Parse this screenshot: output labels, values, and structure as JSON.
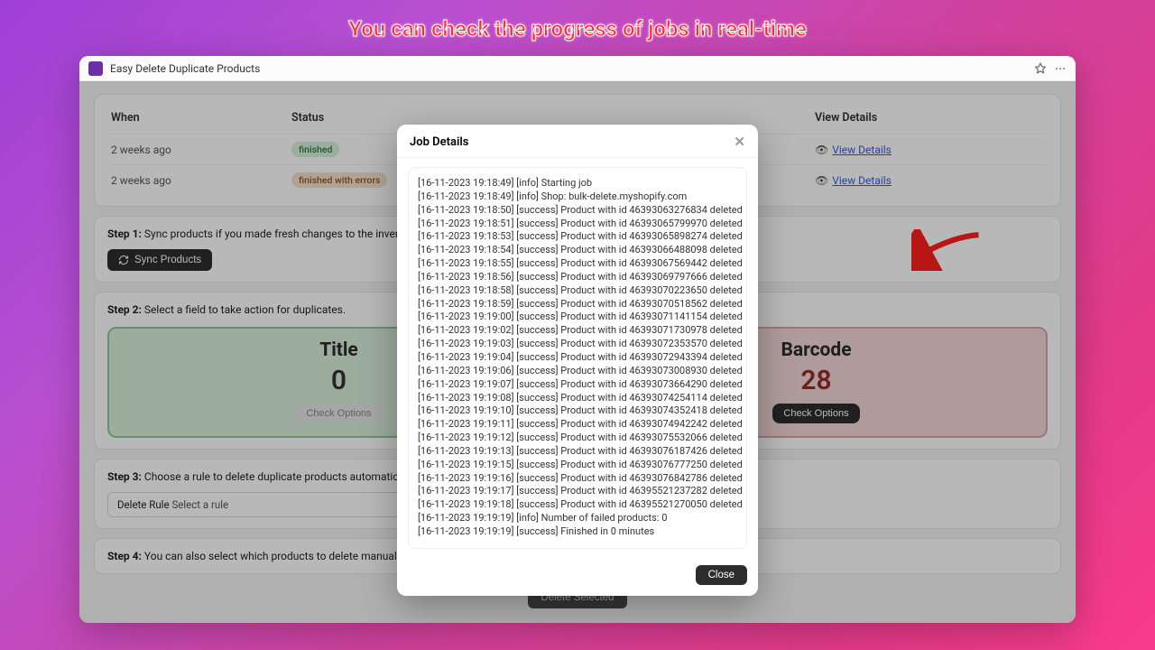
{
  "banner": "You can check the progress of jobs in real-time",
  "app_title": "Easy Delete Duplicate Products",
  "table": {
    "headers": {
      "when": "When",
      "status": "Status",
      "view": "View Details"
    },
    "rows": [
      {
        "when": "2 weeks ago",
        "status_label": "finished",
        "status_kind": "green",
        "view": "View Details"
      },
      {
        "when": "2 weeks ago",
        "status_label": "finished with errors",
        "status_kind": "amber",
        "view": "View Details"
      }
    ]
  },
  "steps": {
    "s1_label": "Step 1:",
    "s1_text": "Sync products if you made fresh changes to the inventory.",
    "sync_btn": "Sync Products",
    "s2_label": "Step 2:",
    "s2_text": "Select a field to take action for duplicates.",
    "s3_label": "Step 3:",
    "s3_text": "Choose a rule to delete duplicate products automatically in bulk.",
    "select_label": "Delete Rule",
    "select_placeholder": "Select a rule",
    "s4_label": "Step 4:",
    "s4_text": "You can also select which products to delete manually.",
    "delete_selected": "Delete Selected"
  },
  "cards": {
    "title_card": {
      "title": "Title",
      "value": "0",
      "btn": "Check Options"
    },
    "barcode_card": {
      "title": "Barcode",
      "value": "28",
      "btn": "Check Options"
    }
  },
  "modal": {
    "title": "Job Details",
    "close": "Close",
    "log": [
      "[16-11-2023 19:18:49] [info] Starting job",
      "[16-11-2023 19:18:49] [info] Shop: bulk-delete.myshopify.com",
      "[16-11-2023 19:18:50] [success] Product with id 46393063276834 deleted",
      "[16-11-2023 19:18:51] [success] Product with id 46393065799970 deleted",
      "[16-11-2023 19:18:53] [success] Product with id 46393065898274 deleted",
      "[16-11-2023 19:18:54] [success] Product with id 46393066488098 deleted",
      "[16-11-2023 19:18:55] [success] Product with id 46393067569442 deleted",
      "[16-11-2023 19:18:56] [success] Product with id 46393069797666 deleted",
      "[16-11-2023 19:18:58] [success] Product with id 46393070223650 deleted",
      "[16-11-2023 19:18:59] [success] Product with id 46393070518562 deleted",
      "[16-11-2023 19:19:00] [success] Product with id 46393071141154 deleted",
      "[16-11-2023 19:19:02] [success] Product with id 46393071730978 deleted",
      "[16-11-2023 19:19:03] [success] Product with id 46393072353570 deleted",
      "[16-11-2023 19:19:04] [success] Product with id 46393072943394 deleted",
      "[16-11-2023 19:19:06] [success] Product with id 46393073008930 deleted",
      "[16-11-2023 19:19:07] [success] Product with id 46393073664290 deleted",
      "[16-11-2023 19:19:08] [success] Product with id 46393074254114 deleted",
      "[16-11-2023 19:19:10] [success] Product with id 46393074352418 deleted",
      "[16-11-2023 19:19:11] [success] Product with id 46393074942242 deleted",
      "[16-11-2023 19:19:12] [success] Product with id 46393075532066 deleted",
      "[16-11-2023 19:19:13] [success] Product with id 46393076187426 deleted",
      "[16-11-2023 19:19:15] [success] Product with id 46393076777250 deleted",
      "[16-11-2023 19:19:16] [success] Product with id 46393076842786 deleted",
      "[16-11-2023 19:19:17] [success] Product with id 46395521237282 deleted",
      "[16-11-2023 19:19:18] [success] Product with id 46395521270050 deleted",
      "[16-11-2023 19:19:19] [info] Number of failed products: 0",
      "[16-11-2023 19:19:19] [success] Finished in 0 minutes"
    ]
  }
}
